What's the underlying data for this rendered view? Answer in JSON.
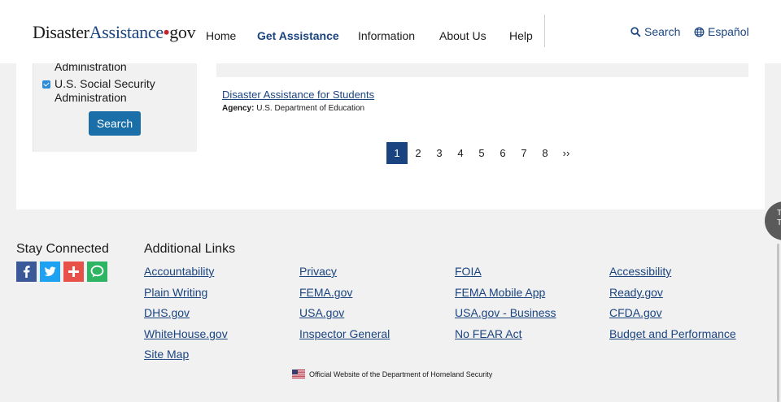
{
  "header": {
    "logo_part1": "Disaster",
    "logo_part2": "Assistance",
    "logo_dot": "•",
    "logo_part3": "gov",
    "nav": [
      "Home",
      "Get Assistance",
      "Information",
      "About Us",
      "Help"
    ],
    "search_label": "Search",
    "language_label": "Español"
  },
  "filters": {
    "prev_item_tail": "Administration",
    "ssa_line1": "U.S. Social Security",
    "ssa_line2": "Administration",
    "search_button": "Search"
  },
  "result": {
    "title": "Disaster Assistance for Students",
    "agency_label": "Agency:",
    "agency_value": "U.S. Department of Education"
  },
  "pagination": {
    "pages": [
      "1",
      "2",
      "3",
      "4",
      "5",
      "6",
      "7",
      "8"
    ],
    "current": "1",
    "next": "››"
  },
  "footer": {
    "stay_connected": "Stay Connected",
    "additional_links": "Additional Links",
    "social_icons": [
      "facebook-icon",
      "twitter-icon",
      "share-plus-icon",
      "chat-icon"
    ],
    "links": {
      "col1": [
        "Accountability",
        "Plain Writing",
        "DHS.gov",
        "WhiteHouse.gov",
        "Site Map"
      ],
      "col2": [
        "Privacy",
        "FEMA.gov",
        "USA.gov",
        "Inspector General"
      ],
      "col3": [
        "FOIA",
        "FEMA Mobile App",
        "USA.gov - Business",
        "No FEAR Act"
      ],
      "col4": [
        "Accessibility",
        "Ready.gov",
        "CFDA.gov",
        "Budget and Performance"
      ]
    },
    "official_text": "Official Website of the Department of Homeland Security"
  },
  "side_tab": {
    "label_line1": "T",
    "label_line2": "T"
  },
  "colors": {
    "primary": "#1a4480",
    "button": "#1a6fa8",
    "logo_dot": "#c2272d",
    "facebook": "#3b5998",
    "twitter": "#1da1f2",
    "share": "#e8514a",
    "chat": "#2eb563"
  }
}
